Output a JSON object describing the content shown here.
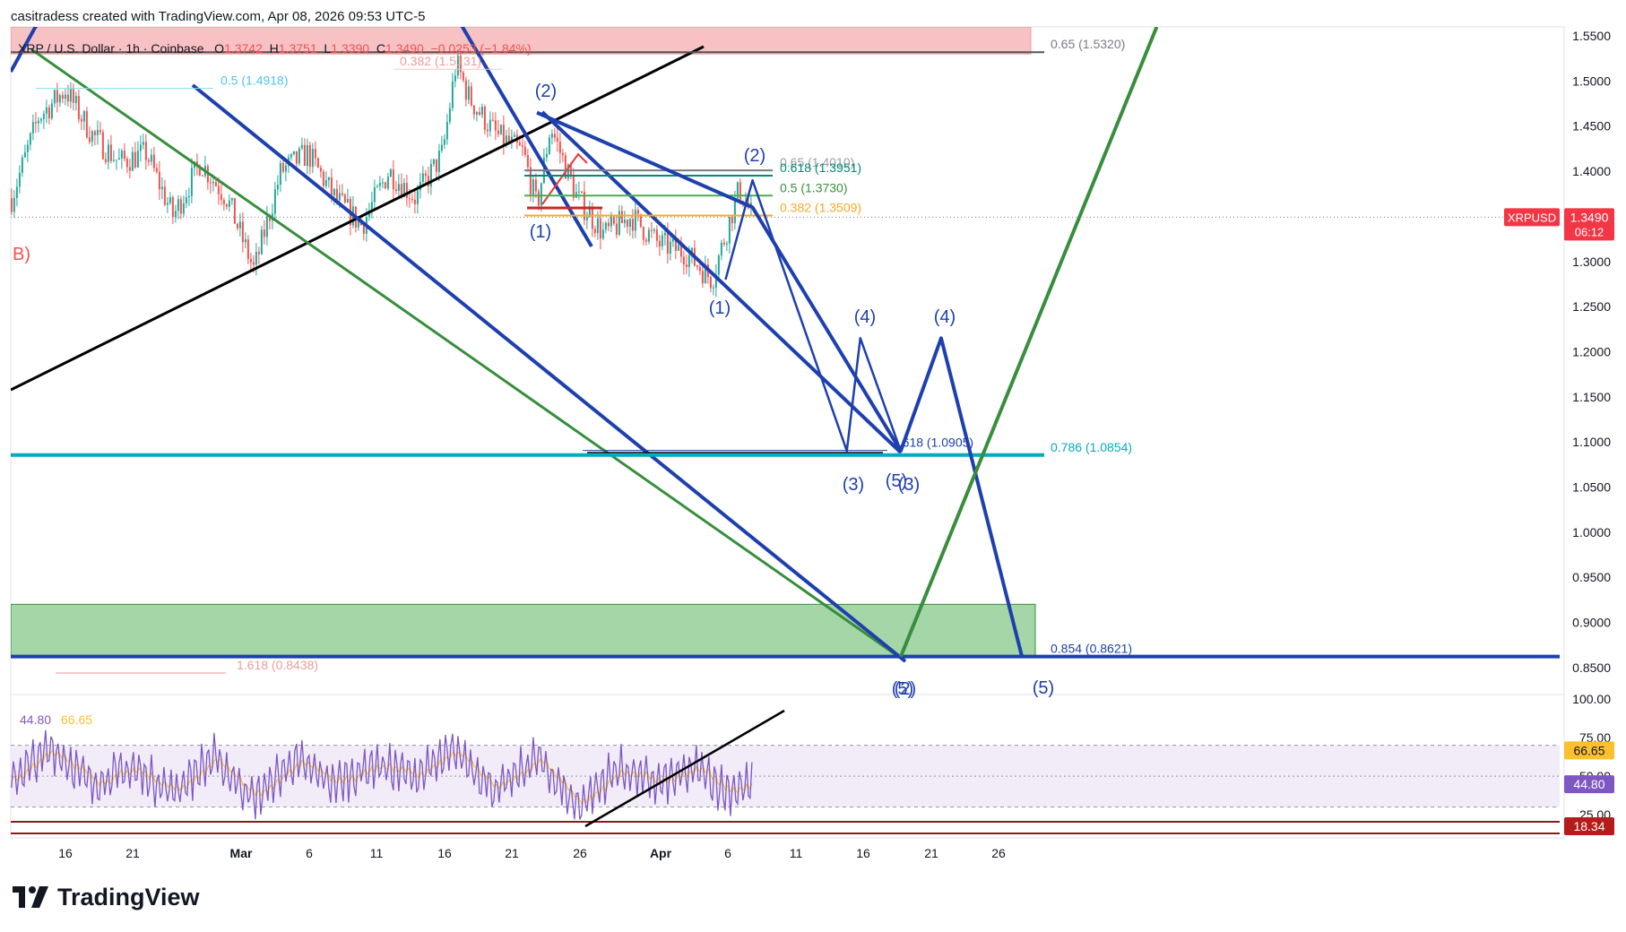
{
  "credit": "casitradess created with TradingView.com, Apr 08, 2026 09:53 UTC-5",
  "brand": "TradingView",
  "brand_icon": "tradingview-logo-icon",
  "header": {
    "symbol": "XRP / U.S. Dollar · 1h · Coinbase",
    "o_label": "O",
    "o": "1.3742",
    "h_label": "H",
    "h": "1.3751",
    "l_label": "L",
    "l": "1.3390",
    "c_label": "C",
    "c": "1.3490",
    "chg": "−0.0253 (−1.84%)"
  },
  "price_tag": {
    "symbol": "XRPUSD",
    "price": "1.3490",
    "countdown": "06:12"
  },
  "colors": {
    "up": "#26a69a",
    "down": "#ef5350",
    "wave": "#1e40af",
    "fib_cyan": "#00acc1",
    "green_line": "#388e3c",
    "green_zone": "#a5d6a7",
    "red_zone": "#f8c1c4",
    "rsi": "#7e57c2",
    "rsi_ma": "#fbc02d"
  },
  "chart_data": [
    {
      "type": "line",
      "title": "XRP / U.S. Dollar · 1h · Coinbase",
      "ylim": [
        0.82,
        1.56
      ],
      "y_ticks": [
        "1.5500",
        "1.5000",
        "1.4500",
        "1.4000",
        "1.3500",
        "1.3000",
        "1.2500",
        "1.2000",
        "1.1500",
        "1.1000",
        "1.0500",
        "1.0000",
        "0.9500",
        "0.9000",
        "0.8500"
      ],
      "x_ticks": [
        "16",
        "21",
        "Mar",
        "6",
        "11",
        "16",
        "21",
        "26",
        "Apr",
        "6",
        "11",
        "16",
        "21",
        "26"
      ],
      "price_path": {
        "x": [
          "Feb 12",
          "Feb 14",
          "Feb 16",
          "Feb 18",
          "Feb 20",
          "Feb 22",
          "Feb 24",
          "Feb 26",
          "Feb 28",
          "Mar 2",
          "Mar 4",
          "Mar 6",
          "Mar 8",
          "Mar 10",
          "Mar 12",
          "Mar 14",
          "Mar 16",
          "Mar 17",
          "Mar 18",
          "Mar 20",
          "Mar 22",
          "Mar 23",
          "Mar 24",
          "Mar 26",
          "Mar 28",
          "Mar 30",
          "Apr 1",
          "Apr 3",
          "Apr 5",
          "Apr 7",
          "Apr 8"
        ],
        "y": [
          1.37,
          1.46,
          1.49,
          1.44,
          1.41,
          1.42,
          1.35,
          1.41,
          1.37,
          1.29,
          1.4,
          1.42,
          1.37,
          1.34,
          1.4,
          1.37,
          1.42,
          1.52,
          1.48,
          1.44,
          1.42,
          1.36,
          1.45,
          1.37,
          1.33,
          1.35,
          1.32,
          1.31,
          1.28,
          1.38,
          1.349
        ]
      },
      "last_price": 1.349,
      "fib_levels": [
        {
          "label": "0.65 (1.5320)",
          "value": 1.532
        },
        {
          "label": "0.5 (1.4918)",
          "value": 1.4918
        },
        {
          "label": "0.382 (1.5131)",
          "value": 1.5131
        },
        {
          "label": "0.65 (1.4010)",
          "value": 1.401
        },
        {
          "label": "0.618 (1.3951)",
          "value": 1.3951
        },
        {
          "label": "0.5 (1.3730)",
          "value": 1.373
        },
        {
          "label": "0.382 (1.3509)",
          "value": 1.3509
        },
        {
          "label": "1.618 (1.0905)",
          "value": 1.0905
        },
        {
          "label": "0.786 (1.0854)",
          "value": 1.0854
        },
        {
          "label": "0.854 (0.8621)",
          "value": 0.8621
        },
        {
          "label": "1.618 (0.8438)",
          "value": 0.8438
        }
      ],
      "zones": [
        {
          "name": "resistance zone",
          "from": 1.53,
          "to": 1.56
        },
        {
          "name": "support zone",
          "from": 0.8621,
          "to": 0.92
        }
      ],
      "wave_labels": [
        "B)",
        "(2)",
        "(1)",
        "(2)",
        "(1)",
        "(4)",
        "(4)",
        "(3)",
        "(5)",
        "(3)",
        "(5)",
        "(5)",
        "(2)"
      ],
      "wave_paths": [
        {
          "name": "primary projection",
          "x": [
            "Apr 6",
            "Apr 8",
            "Apr 15",
            "Apr 16",
            "Apr 19"
          ],
          "y": [
            1.28,
            1.39,
            1.09,
            1.215,
            1.09
          ]
        },
        {
          "name": "alternate projection",
          "x": [
            "Mar 23",
            "Apr 8",
            "Apr 19",
            "Apr 22",
            "Apr 28"
          ],
          "y": [
            1.465,
            1.36,
            1.09,
            1.215,
            0.862
          ]
        },
        {
          "name": "recovery projection",
          "x": [
            "Apr 19",
            "May 8"
          ],
          "y": [
            0.862,
            1.56
          ]
        }
      ]
    },
    {
      "type": "line",
      "title": "RSI",
      "ylim": [
        10,
        100
      ],
      "y_ticks": [
        "100.00",
        "75.00",
        "50.00",
        "25.00"
      ],
      "levels": [
        70,
        50,
        30
      ],
      "rsi_value": 44.8,
      "rsi_ma_value": 66.65,
      "lower_value": 18.34,
      "series": [
        {
          "name": "",
          "x": [
            "Feb 12",
            "Feb 15",
            "Feb 18",
            "Feb 21",
            "Feb 24",
            "Feb 27",
            "Mar 2",
            "Mar 5",
            "Mar 8",
            "Mar 11",
            "Mar 14",
            "Mar 17",
            "Mar 20",
            "Mar 23",
            "Mar 26",
            "Mar 29",
            "Apr 1",
            "Apr 4",
            "Apr 6",
            "Apr 8"
          ],
          "values": [
            48,
            68,
            45,
            55,
            40,
            62,
            35,
            60,
            45,
            58,
            50,
            66,
            40,
            62,
            30,
            55,
            45,
            55,
            40,
            44.8
          ]
        }
      ]
    }
  ]
}
